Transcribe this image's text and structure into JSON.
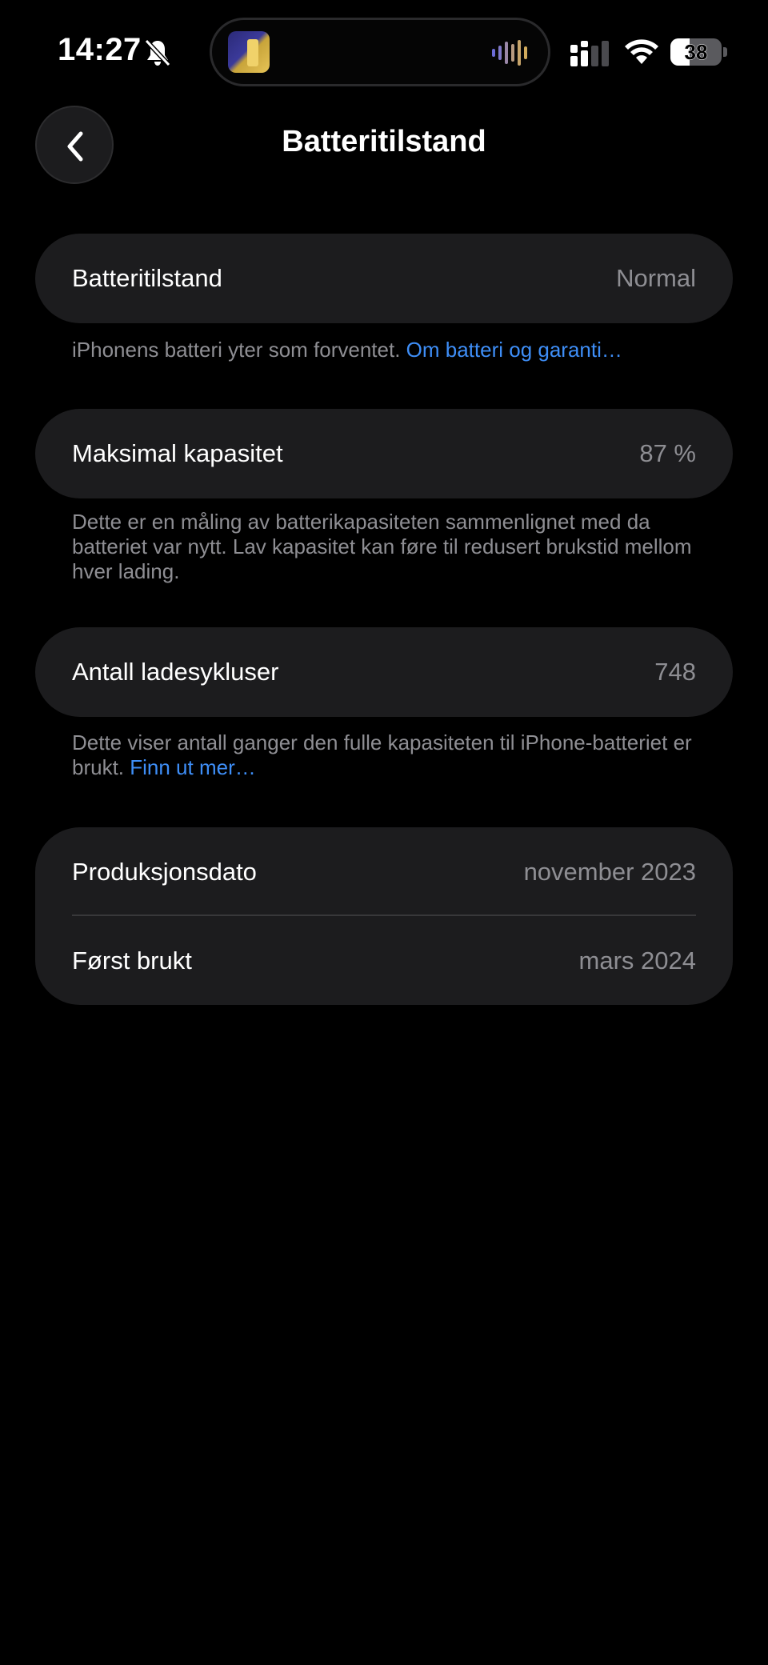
{
  "status_bar": {
    "time": "14:27",
    "battery_level": "38",
    "battery_fraction": 0.38,
    "icons": [
      "bell-slash-icon",
      "album-artwork",
      "waveform-icon",
      "cellular-signal-icon",
      "wifi-icon",
      "battery-icon"
    ]
  },
  "nav": {
    "title": "Batteritilstand",
    "back_icon": "chevron-left-icon"
  },
  "battery_health": {
    "label": "Batteritilstand",
    "value": "Normal",
    "footnote_text": "iPhonens batteri yter som forventet. ",
    "footnote_link": "Om batteri og garanti…"
  },
  "max_capacity": {
    "label": "Maksimal kapasitet",
    "value": "87 %",
    "footnote_text": "Dette er en måling av batterikapasiteten sammenlignet med da batteriet var nytt. Lav kapasitet kan føre til redusert brukstid mellom hver lading."
  },
  "cycle_count": {
    "label": "Antall ladesykluser",
    "value": "748",
    "footnote_text": "Dette viser antall ganger den fulle kapasiteten til iPhone-batteriet er brukt. ",
    "footnote_link": "Finn ut mer…"
  },
  "dates": {
    "manufacture_label": "Produksjonsdato",
    "manufacture_value": "november 2023",
    "first_use_label": "Først brukt",
    "first_use_value": "mars 2024"
  },
  "colors": {
    "background": "#000000",
    "card": "#1c1c1e",
    "secondary_text": "#8e8e93",
    "link": "#3e8ef7"
  }
}
